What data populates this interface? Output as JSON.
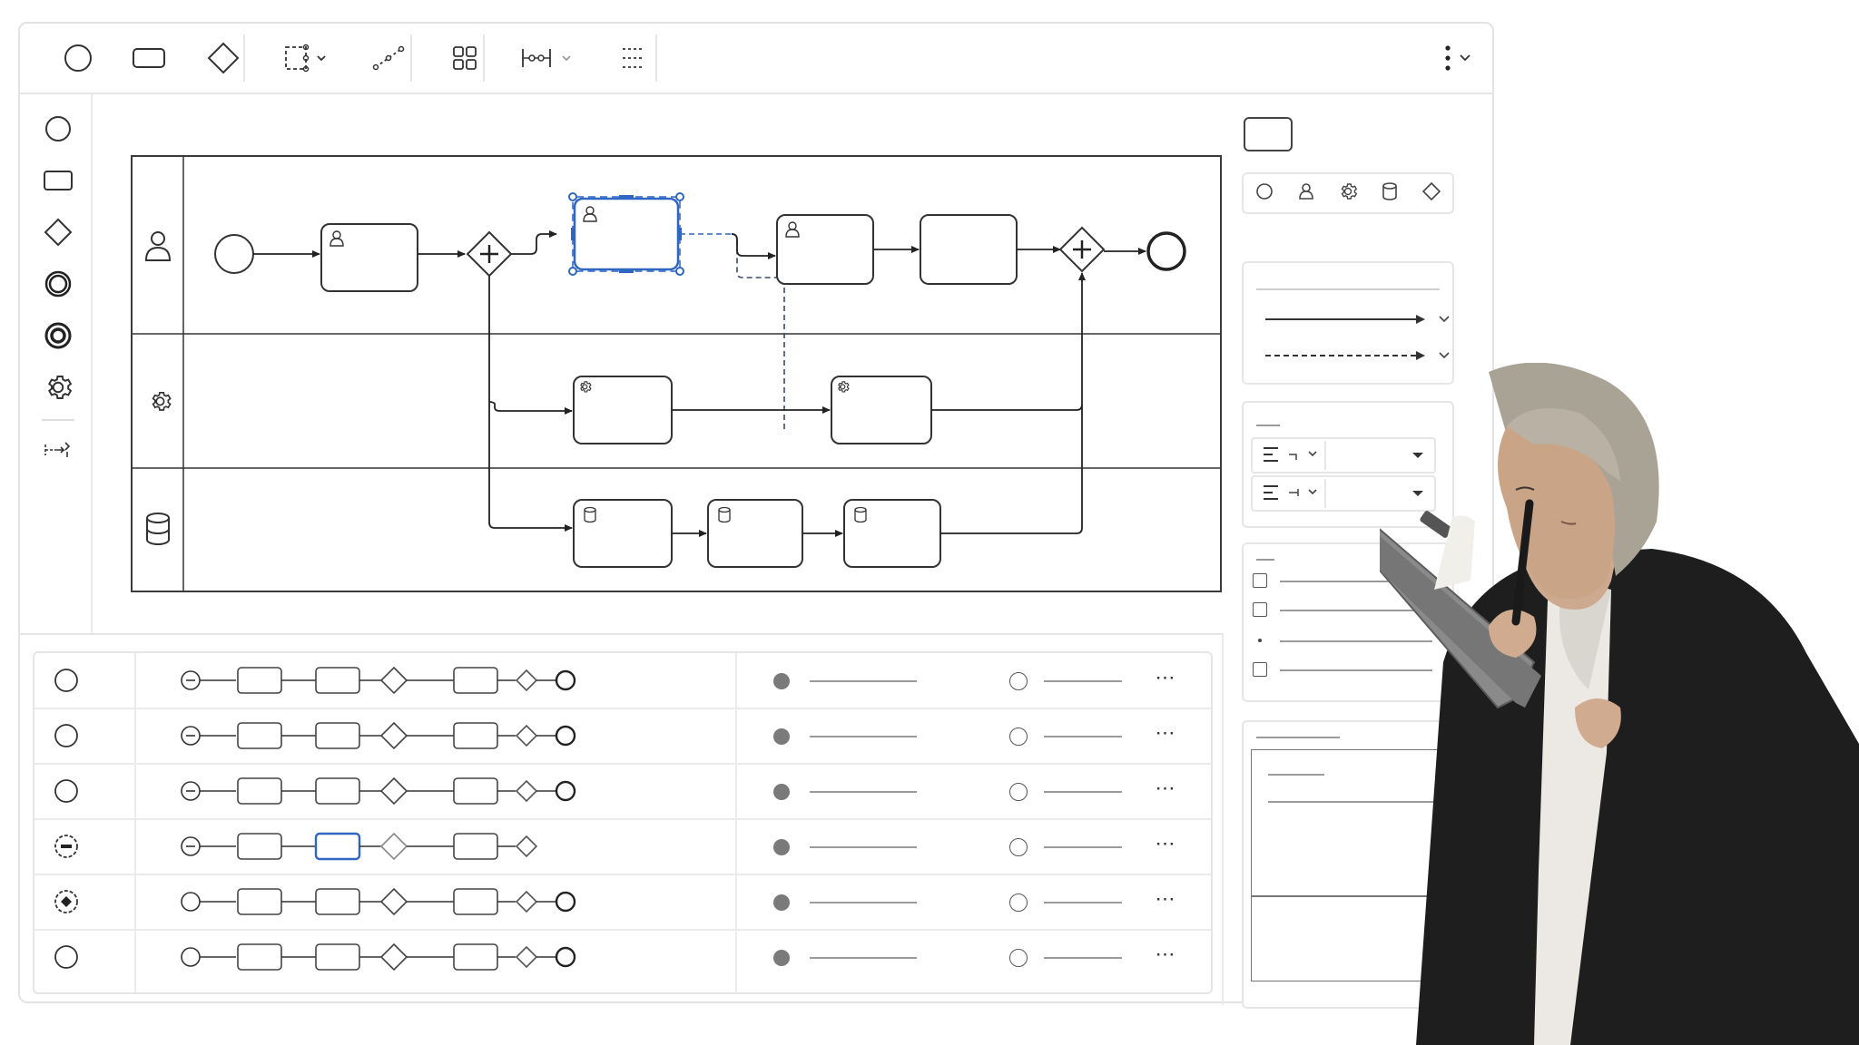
{
  "toolbar": {
    "tools": [
      "start-event",
      "task",
      "gateway",
      "lasso-select",
      "connect",
      "grid",
      "align-distribute",
      "distribute"
    ],
    "more_menu": "more-vertical"
  },
  "left_toolbox": [
    "start-event",
    "task",
    "gateway",
    "intermediate-event",
    "end-event",
    "service-task",
    "space-tool"
  ],
  "diagram": {
    "lanes": [
      {
        "icon": "user-icon"
      },
      {
        "icon": "gear-icon"
      },
      {
        "icon": "database-icon"
      }
    ],
    "selected_task": "user-task-2"
  },
  "instances_table": {
    "rows": [
      {
        "status_icon": "circle",
        "path_complete": true,
        "more": "⋯"
      },
      {
        "status_icon": "circle",
        "path_complete": true,
        "more": "⋯"
      },
      {
        "status_icon": "circle",
        "path_complete": true,
        "more": "⋯"
      },
      {
        "status_icon": "minus-dashed-circle",
        "path_complete": false,
        "more": "⋯"
      },
      {
        "status_icon": "diamond-dashed-circle",
        "path_complete": true,
        "more": "⋯"
      },
      {
        "status_icon": "circle",
        "path_complete": true,
        "more": "⋯"
      }
    ]
  },
  "properties_panel": {
    "element_types": [
      "circle",
      "user",
      "gear",
      "database",
      "diamond"
    ],
    "connection_styles": [
      "solid-arrow",
      "dashed-arrow"
    ],
    "checkbox_items": 3
  },
  "colors": {
    "accent": "#2f66c2",
    "stroke": "#333333",
    "border": "#e5e5e5"
  }
}
